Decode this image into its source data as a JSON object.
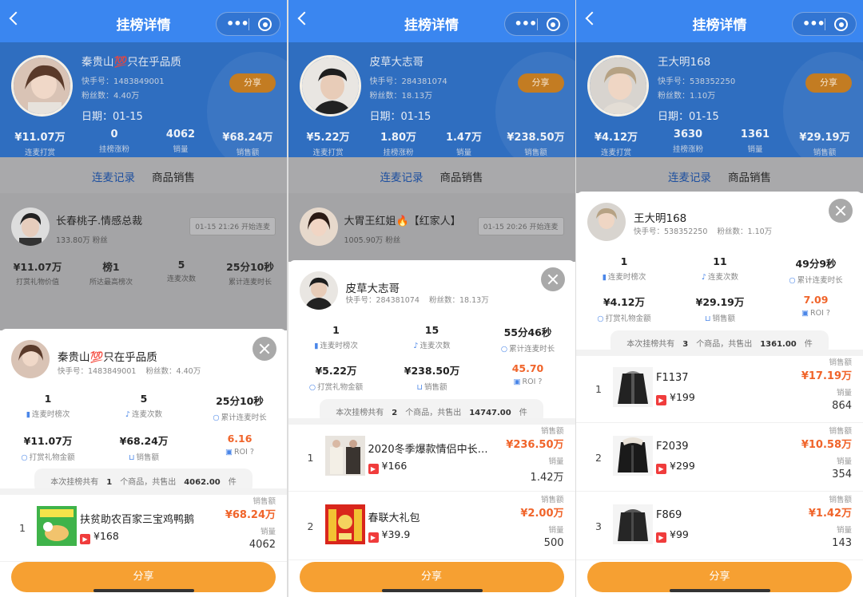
{
  "panels": [
    {
      "nav_title": "挂榜详情",
      "header": {
        "name": "秦贵山💯只在乎品质",
        "id": "快手号：1483849001",
        "fans": "粉丝数：4.40万",
        "date": "日期：01-15",
        "share": "分享",
        "stats": [
          {
            "value": "¥11.07万",
            "label": "连麦打赏"
          },
          {
            "value": "0",
            "label": "挂榜涨粉"
          },
          {
            "value": "4062",
            "label": "销量"
          },
          {
            "value": "¥68.24万",
            "label": "销售额"
          }
        ]
      },
      "tabs": [
        "连麦记录",
        "商品销售"
      ],
      "bg_row": {
        "name": "长春桃子.情感总裁",
        "fans": "133.80万 粉丝",
        "time": "01-15 21:26 开始连麦",
        "stats": [
          {
            "value": "¥11.07万",
            "label": "打赏礼物价值"
          },
          {
            "value": "榜1",
            "label": "所达最高榜次"
          },
          {
            "value": "5",
            "label": "连麦次数"
          },
          {
            "value": "25分10秒",
            "label": "累计连麦时长"
          }
        ]
      },
      "sheet": {
        "name": "秦贵山💯只在乎品质",
        "id": "快手号：1483849001",
        "fans": "粉丝数：4.40万",
        "stats": [
          {
            "value": "1",
            "label": "连麦时榜次"
          },
          {
            "value": "5",
            "label": "连麦次数"
          },
          {
            "value": "25分10秒",
            "label": "累计连麦时长"
          },
          {
            "value": "¥11.07万",
            "label": "打赏礼物金额"
          },
          {
            "value": "¥68.24万",
            "label": "销售额"
          },
          {
            "value": "6.16",
            "label": "ROI"
          }
        ],
        "summary_pre": "本次挂榜共有",
        "summary_count": "1",
        "summary_mid": "个商品，共售出",
        "summary_sold": "4062.00",
        "summary_post": "件",
        "products": [
          {
            "index": "1",
            "name": "扶贫助农百家三宝鸡鸭鹅",
            "price": "¥168",
            "amount_label": "销售额",
            "amount": "¥68.24万",
            "count_label": "销量",
            "count": "4062"
          }
        ]
      },
      "share_button": "分享"
    },
    {
      "nav_title": "挂榜详情",
      "header": {
        "name": "皮草大志哥",
        "id": "快手号：284381074",
        "fans": "粉丝数：18.13万",
        "date": "日期：01-15",
        "share": "分享",
        "stats": [
          {
            "value": "¥5.22万",
            "label": "连麦打赏"
          },
          {
            "value": "1.80万",
            "label": "挂榜涨粉"
          },
          {
            "value": "1.47万",
            "label": "销量"
          },
          {
            "value": "¥238.50万",
            "label": "销售额"
          }
        ]
      },
      "tabs": [
        "连麦记录",
        "商品销售"
      ],
      "bg_row": {
        "name": "大胃王红姐🔥【红家人】",
        "fans": "1005.90万 粉丝",
        "time": "01-15 20:26 开始连麦",
        "stats": []
      },
      "sheet": {
        "name": "皮草大志哥",
        "id": "快手号：284381074",
        "fans": "粉丝数：18.13万",
        "stats": [
          {
            "value": "1",
            "label": "连麦时榜次"
          },
          {
            "value": "15",
            "label": "连麦次数"
          },
          {
            "value": "55分46秒",
            "label": "累计连麦时长"
          },
          {
            "value": "¥5.22万",
            "label": "打赏礼物金额"
          },
          {
            "value": "¥238.50万",
            "label": "销售额"
          },
          {
            "value": "45.70",
            "label": "ROI"
          }
        ],
        "summary_pre": "本次挂榜共有",
        "summary_count": "2",
        "summary_mid": "个商品，共售出",
        "summary_sold": "14747.00",
        "summary_post": "件",
        "products": [
          {
            "index": "1",
            "name": "2020冬季爆款情侣中长…",
            "price": "¥166",
            "amount_label": "销售额",
            "amount": "¥236.50万",
            "count_label": "销量",
            "count": "1.42万"
          },
          {
            "index": "2",
            "name": "春联大礼包",
            "price": "¥39.9",
            "amount_label": "销售额",
            "amount": "¥2.00万",
            "count_label": "销量",
            "count": "500"
          }
        ]
      },
      "share_button": "分享"
    },
    {
      "nav_title": "挂榜详情",
      "header": {
        "name": "王大明168",
        "id": "快手号：538352250",
        "fans": "粉丝数：1.10万",
        "date": "日期：01-15",
        "share": "分享",
        "stats": [
          {
            "value": "¥4.12万",
            "label": "连麦打赏"
          },
          {
            "value": "3630",
            "label": "挂榜涨粉"
          },
          {
            "value": "1361",
            "label": "销量"
          },
          {
            "value": "¥29.19万",
            "label": "销售额"
          }
        ]
      },
      "tabs": [
        "连麦记录",
        "商品销售"
      ],
      "bg_row": null,
      "sheet": {
        "name": "王大明168",
        "id": "快手号：538352250",
        "fans": "粉丝数：1.10万",
        "stats": [
          {
            "value": "1",
            "label": "连麦时榜次"
          },
          {
            "value": "11",
            "label": "连麦次数"
          },
          {
            "value": "49分9秒",
            "label": "累计连麦时长"
          },
          {
            "value": "¥4.12万",
            "label": "打赏礼物金额"
          },
          {
            "value": "¥29.19万",
            "label": "销售额"
          },
          {
            "value": "7.09",
            "label": "ROI"
          }
        ],
        "summary_pre": "本次挂榜共有",
        "summary_count": "3",
        "summary_mid": "个商品，共售出",
        "summary_sold": "1361.00",
        "summary_post": "件",
        "products": [
          {
            "index": "1",
            "name": "F1137",
            "price": "¥199",
            "amount_label": "销售额",
            "amount": "¥17.19万",
            "count_label": "销量",
            "count": "864"
          },
          {
            "index": "2",
            "name": "F2039",
            "price": "¥299",
            "amount_label": "销售额",
            "amount": "¥10.58万",
            "count_label": "销量",
            "count": "354"
          },
          {
            "index": "3",
            "name": "F869",
            "price": "¥99",
            "amount_label": "销售额",
            "amount": "¥1.42万",
            "count_label": "销量",
            "count": "143"
          }
        ]
      },
      "share_button": "分享"
    }
  ],
  "colors": {
    "nav_blue": "#3a86f0",
    "orange": "#f0642a",
    "share_orange": "#f6a032"
  }
}
